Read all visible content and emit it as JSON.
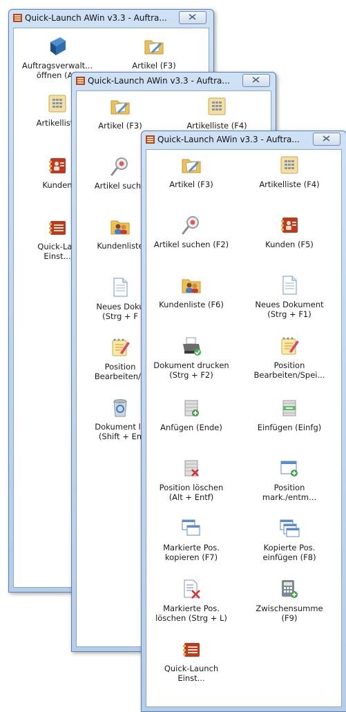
{
  "windows": [
    {
      "title": "Quick-Launch AWin v3.3 - Auftra...",
      "tiles": [
        {
          "label": "Auftragsverwalt...\nöffnen (Alt",
          "icon": "book-icon"
        },
        {
          "label": "Artikel (F3)",
          "icon": "folder-edit-icon"
        },
        {
          "label": "Artikelliste",
          "icon": "list-folder-icon"
        },
        {
          "label": "Kunden",
          "icon": "contact-card-icon"
        },
        {
          "label": "Quick-Lau\nEinst...",
          "icon": "settings-card-icon"
        }
      ]
    },
    {
      "title": "Quick-Launch AWin v3.3 - Auftra...",
      "tiles": [
        {
          "label": "Artikel (F3)",
          "icon": "folder-edit-icon"
        },
        {
          "label": "Artikelliste (F4)",
          "icon": "list-folder-icon"
        },
        {
          "label": "Artikel suche",
          "icon": "magnifier-icon"
        },
        {
          "label": "Kundenliste",
          "icon": "customers-folder-icon"
        },
        {
          "label": "Neues Doku\n(Strg + F",
          "icon": "document-icon"
        },
        {
          "label": "Position\nBearbeiten/S",
          "icon": "edit-notepad-icon"
        },
        {
          "label": "Dokument lö\n(Shift + En",
          "icon": "trash-icon"
        }
      ]
    },
    {
      "title": "Quick-Launch AWin v3.3 - Auftra...",
      "tiles": [
        {
          "label": "Artikel (F3)",
          "icon": "folder-edit-icon"
        },
        {
          "label": "Artikelliste (F4)",
          "icon": "list-folder-icon"
        },
        {
          "label": "Artikel suchen (F2)",
          "icon": "magnifier-icon"
        },
        {
          "label": "Kunden (F5)",
          "icon": "contact-card-icon"
        },
        {
          "label": "Kundenliste (F6)",
          "icon": "customers-folder-icon"
        },
        {
          "label": "Neues Dokument\n(Strg + F1)",
          "icon": "document-icon"
        },
        {
          "label": "Dokument drucken\n(Strg + F2)",
          "icon": "printer-icon"
        },
        {
          "label": "Position\nBearbeiten/Spei...",
          "icon": "edit-notepad-icon"
        },
        {
          "label": "Anfügen (Ende)",
          "icon": "row-add-icon"
        },
        {
          "label": "Einfügen (Einfg)",
          "icon": "row-insert-icon"
        },
        {
          "label": "Position löschen\n(Alt + Entf)",
          "icon": "row-delete-icon"
        },
        {
          "label": "Position\nmark./entm...",
          "icon": "window-mark-icon"
        },
        {
          "label": "Markierte Pos.\nkopieren (F7)",
          "icon": "windows-copy-icon"
        },
        {
          "label": "Kopierte Pos.\neinfügen (F8)",
          "icon": "windows-paste-icon"
        },
        {
          "label": "Markierte Pos.\nlöschen (Strg + L)",
          "icon": "list-delete-icon"
        },
        {
          "label": "Zwischensumme\n(F9)",
          "icon": "calculator-icon"
        },
        {
          "label": "Quick-Launch\nEinst...",
          "icon": "settings-card-icon"
        }
      ]
    }
  ]
}
